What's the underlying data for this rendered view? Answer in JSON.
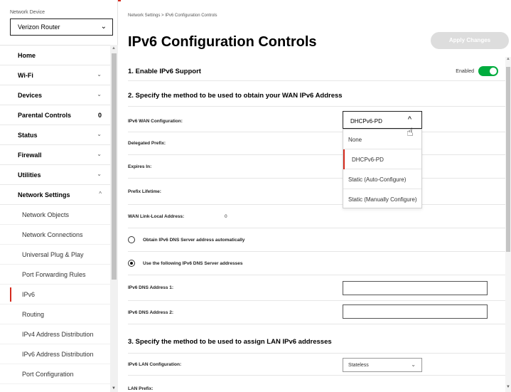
{
  "colors": {
    "accent": "#d52b1e",
    "toggle_on": "#00ac3e",
    "apply_disabled": "#dddddd"
  },
  "sidebar": {
    "device_label": "Network Device",
    "device_value": "Verizon Router",
    "items": [
      {
        "label": "Home",
        "chevron": "",
        "count": ""
      },
      {
        "label": "Wi-Fi",
        "chevron": "⌄",
        "count": ""
      },
      {
        "label": "Devices",
        "chevron": "⌄",
        "count": ""
      },
      {
        "label": "Parental Controls",
        "chevron": "",
        "count": "0"
      },
      {
        "label": "Status",
        "chevron": "⌄",
        "count": ""
      },
      {
        "label": "Firewall",
        "chevron": "⌄",
        "count": ""
      },
      {
        "label": "Utilities",
        "chevron": "⌄",
        "count": ""
      },
      {
        "label": "Network Settings",
        "chevron": "^",
        "count": ""
      }
    ],
    "sub_items": [
      {
        "label": "Network Objects"
      },
      {
        "label": "Network Connections"
      },
      {
        "label": "Universal Plug & Play"
      },
      {
        "label": "Port Forwarding Rules"
      },
      {
        "label": "IPv6",
        "active": true
      },
      {
        "label": "Routing"
      },
      {
        "label": "IPv4 Address Distribution"
      },
      {
        "label": "IPv6 Address Distribution"
      },
      {
        "label": "Port Configuration"
      }
    ]
  },
  "main": {
    "breadcrumb": "Network Settings  >  IPv6 Configuration Controls",
    "title": "IPv6 Configuration Controls",
    "apply_label": "Apply Changes",
    "section1": {
      "title": "1. Enable IPv6 Support",
      "toggle_label": "Enabled",
      "toggle_on": true
    },
    "section2": {
      "title": "2. Specify the method to be used to obtain your WAN IPv6 Address",
      "wan_config_label": "IPv6 WAN Configuration:",
      "wan_config_value": "DHCPv6-PD",
      "delegated_prefix_label": "Delegated Prefix:",
      "expires_label": "Expires In:",
      "prefix_lifetime_label": "Prefix Lifetime:",
      "link_local_label": "WAN Link-Local Address:",
      "link_local_value": "0",
      "dns_auto_label": "Obtain IPv6 DNS Server address automatically",
      "dns_manual_label": "Use the following IPv6 DNS Server addresses",
      "dns1_label": "IPv6 DNS Address 1:",
      "dns2_label": "IPv6 DNS Address 2:",
      "dns1_value": "",
      "dns2_value": ""
    },
    "dropdown_options": [
      {
        "label": "None"
      },
      {
        "label": "DHCPv6-PD",
        "selected": true
      },
      {
        "label": "Static (Auto-Configure)"
      },
      {
        "label": "Static (Manually Configure)"
      }
    ],
    "section3": {
      "title": "3. Specify the method to be used to assign LAN IPv6 addresses",
      "lan_config_label": "IPv6 LAN Configuration:",
      "lan_config_value": "Stateless",
      "lan_prefix_label": "LAN Prefix:"
    }
  }
}
